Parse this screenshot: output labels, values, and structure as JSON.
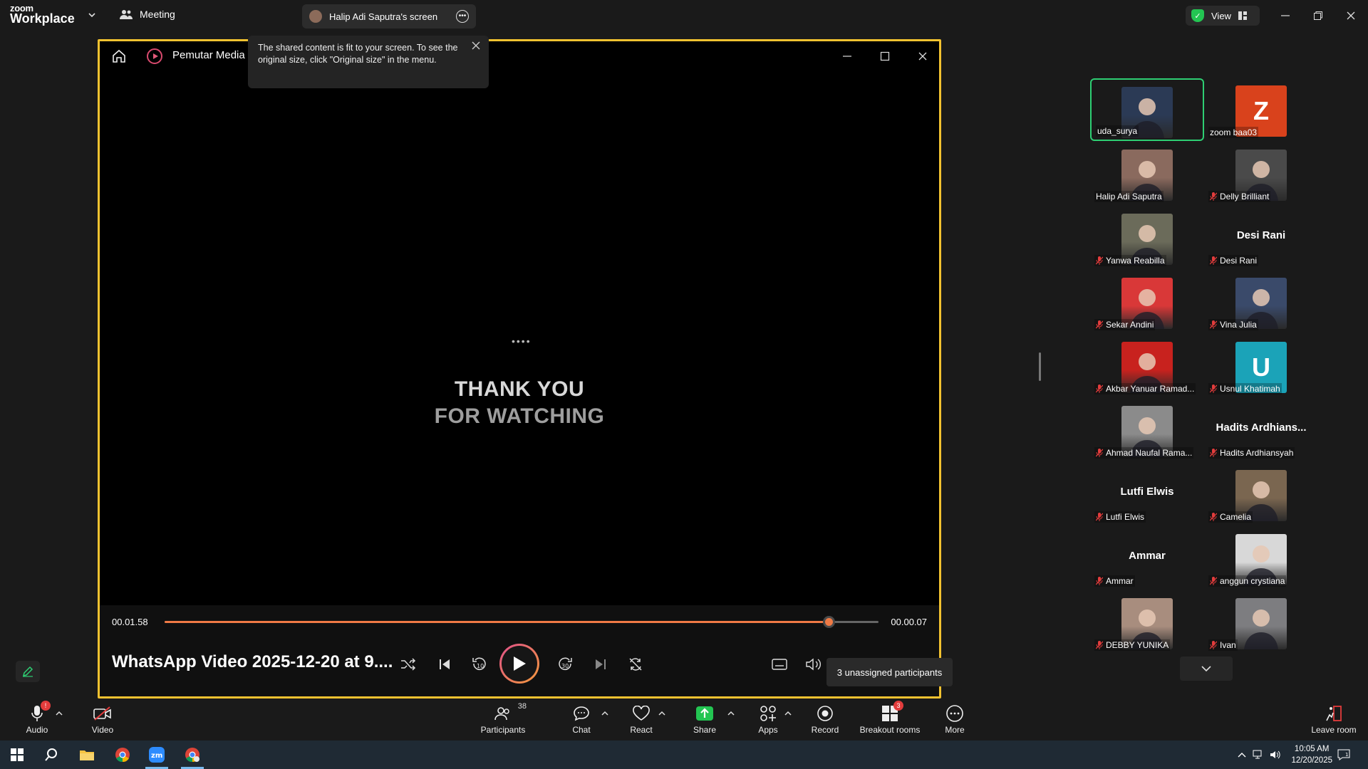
{
  "app": {
    "brand_small": "zoom",
    "brand_large": "Workplace",
    "meeting_label": "Meeting",
    "shared_screen_label": "Halip Adi Saputra's screen",
    "view_label": "View"
  },
  "media_player": {
    "app_name": "Pemutar Media",
    "video_text_line1": "THANK YOU",
    "video_text_line2": "FOR WATCHING",
    "loader": "••••",
    "current_time": "00.01.58",
    "remaining_time": "00.00.07",
    "progress": 0.93,
    "video_title": "WhatsApp Video 2025-12-20 at 9...."
  },
  "tooltip": {
    "text": "The shared content is fit to your screen. To see the original size, click \"Original size\" in the menu."
  },
  "participants": [
    {
      "name": "uda_surya",
      "muted": false,
      "kind": "photo",
      "color": "#2b3a55",
      "active": true
    },
    {
      "name": "zoom baa03",
      "muted": false,
      "kind": "initial",
      "initial": "Z",
      "color": "#d9421c"
    },
    {
      "name": "Halip Adi Saputra",
      "muted": false,
      "kind": "photo",
      "color": "#8a6a5e"
    },
    {
      "name": "Delly Brilliant",
      "muted": true,
      "kind": "photo",
      "color": "#4a4a4a"
    },
    {
      "name": "Yanwa Reabilla",
      "muted": true,
      "kind": "photo",
      "color": "#6b6b5a"
    },
    {
      "name": "Desi Rani",
      "muted": true,
      "kind": "text",
      "display": "Desi Rani"
    },
    {
      "name": "Sekar Andini",
      "muted": true,
      "kind": "photo",
      "color": "#d93838"
    },
    {
      "name": "Vina Julia",
      "muted": true,
      "kind": "photo",
      "color": "#3a4a6a"
    },
    {
      "name": "Akbar Yanuar Ramad...",
      "muted": true,
      "kind": "photo",
      "color": "#c8221e"
    },
    {
      "name": "Usnul Khatimah",
      "muted": true,
      "kind": "initial",
      "initial": "U",
      "color": "#1ba3b8"
    },
    {
      "name": "Ahmad Naufal Rama...",
      "muted": true,
      "kind": "photo",
      "color": "#8b8b8b"
    },
    {
      "name": "Hadits Ardhiansyah",
      "muted": true,
      "kind": "text",
      "display": "Hadits  Ardhians..."
    },
    {
      "name": "Lutfi Elwis",
      "muted": true,
      "kind": "text",
      "display": "Lutfi Elwis"
    },
    {
      "name": "Camelia",
      "muted": true,
      "kind": "photo",
      "color": "#7a6650"
    },
    {
      "name": "Ammar",
      "muted": true,
      "kind": "text",
      "display": "Ammar"
    },
    {
      "name": "anggun crystiana",
      "muted": true,
      "kind": "photo",
      "color": "#d8d8d8"
    },
    {
      "name": "DEBBY YUNIKA",
      "muted": true,
      "kind": "photo",
      "color": "#a88d7e"
    },
    {
      "name": "Ivan",
      "muted": true,
      "kind": "photo",
      "color": "#7d7d80"
    }
  ],
  "unassigned_label": "3 unassigned participants",
  "toolbar": {
    "audio": "Audio",
    "audio_badge": "!",
    "video": "Video",
    "participants": "Participants",
    "participants_count": "38",
    "chat": "Chat",
    "react": "React",
    "share": "Share",
    "apps": "Apps",
    "record": "Record",
    "breakout": "Breakout rooms",
    "breakout_badge": "3",
    "more": "More",
    "leave": "Leave room"
  },
  "taskbar": {
    "time": "10:05 AM",
    "date": "12/20/2025",
    "notif_count": "1"
  },
  "colors": {
    "accent_border": "#f2c230",
    "active_speaker": "#2ecf73",
    "seek": "#f07a45",
    "share_green": "#23c552"
  }
}
